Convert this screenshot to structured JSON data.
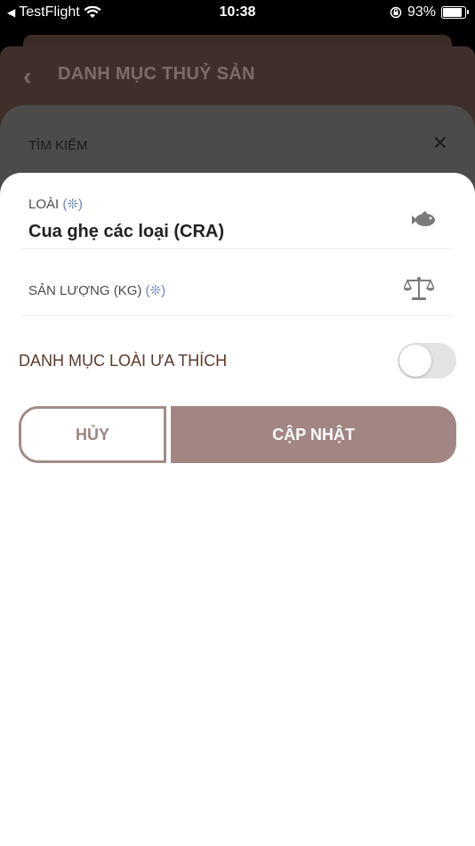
{
  "status_bar": {
    "back_app": "TestFlight",
    "time": "10:38",
    "battery": "93%"
  },
  "background": {
    "header_title": "DANH MỤC THUỶ SẢN",
    "search_label": "TÌM KIẾM"
  },
  "form": {
    "species": {
      "label": "LOÀI",
      "required_mark": "(❊)",
      "value": "Cua ghẹ các loại (CRA)"
    },
    "quantity": {
      "label": "SẢN LƯỢNG (KG)",
      "required_mark": "(❊)",
      "value": ""
    },
    "favorite": {
      "label": "DANH MỤC LOÀI ƯA THÍCH",
      "enabled": false
    },
    "cancel_label": "HỦY",
    "update_label": "CẬP NHẬT"
  },
  "colors": {
    "accent": "#a18683",
    "required": "#6b87b4",
    "favorite_text": "#5b3a2c"
  },
  "icons": {
    "species": "fish-icon",
    "quantity": "scale-icon"
  }
}
